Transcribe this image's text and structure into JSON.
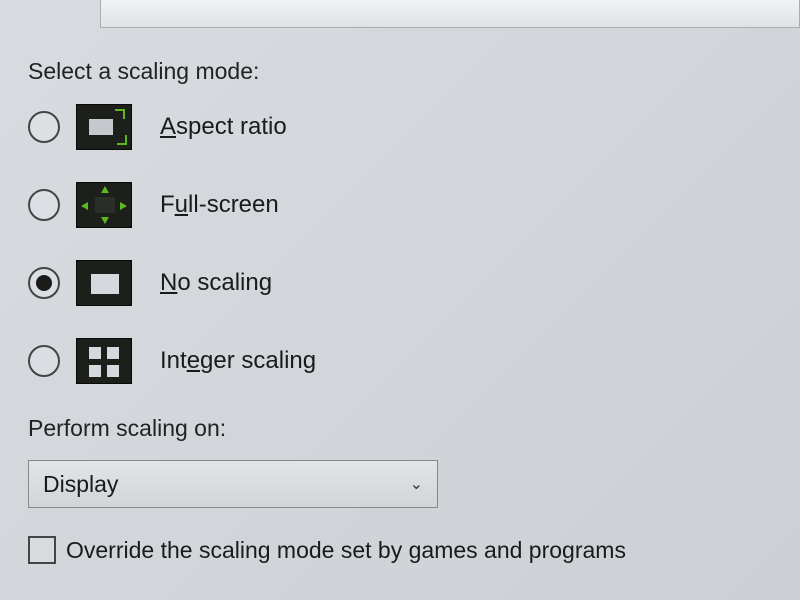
{
  "section": {
    "title": "Select a scaling mode:"
  },
  "options": {
    "aspect": {
      "label_pre": "",
      "label_u": "A",
      "label_post": "spect ratio",
      "selected": false
    },
    "full": {
      "label_pre": "F",
      "label_u": "u",
      "label_post": "ll-screen",
      "selected": false
    },
    "none": {
      "label_pre": "",
      "label_u": "N",
      "label_post": "o scaling",
      "selected": true
    },
    "integer": {
      "label_pre": "Int",
      "label_u": "e",
      "label_post": "ger scaling",
      "selected": false
    }
  },
  "perform": {
    "label": "Perform scaling on:",
    "selected": "Display"
  },
  "override": {
    "label": "Override the scaling mode set by games and programs",
    "checked": false
  }
}
